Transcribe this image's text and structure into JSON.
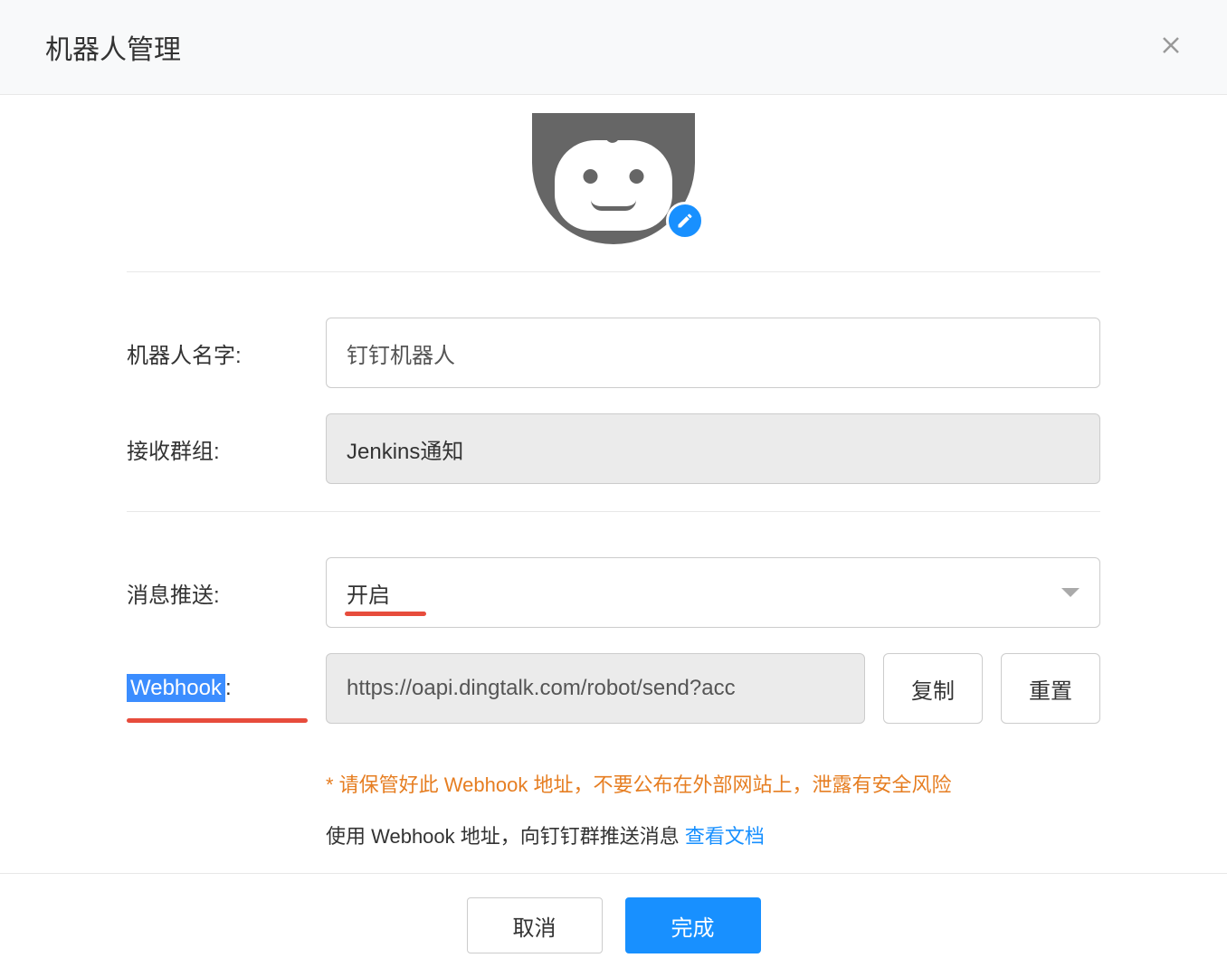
{
  "header": {
    "title": "机器人管理"
  },
  "form": {
    "robot_name": {
      "label": "机器人名字:",
      "value": "钉钉机器人"
    },
    "group": {
      "label": "接收群组:",
      "value": "Jenkins通知"
    },
    "push": {
      "label": "消息推送:",
      "selected": "开启"
    },
    "webhook": {
      "label_highlight": "Webhook",
      "label_suffix": ":",
      "value": "https://oapi.dingtalk.com/robot/send?acc",
      "copy_label": "复制",
      "reset_label": "重置"
    }
  },
  "hints": {
    "warning": "* 请保管好此 Webhook 地址，不要公布在外部网站上，泄露有安全风险",
    "info_prefix": "使用 Webhook 地址，向钉钉群推送消息 ",
    "doc_link": "查看文档"
  },
  "footer": {
    "cancel": "取消",
    "submit": "完成"
  }
}
